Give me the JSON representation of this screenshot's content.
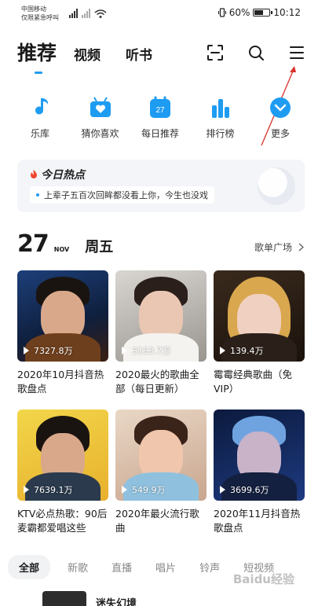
{
  "status_bar": {
    "carrier_line1": "中国移动",
    "carrier_line2": "仅限紧急呼叫",
    "battery": "60%",
    "time": "10:12",
    "battery_level": 0.6
  },
  "top_tabs": {
    "active": "推荐",
    "items": [
      "视频",
      "听书"
    ],
    "icons": [
      "scan-icon",
      "search-icon",
      "menu-icon"
    ]
  },
  "quick_entries": [
    {
      "label": "乐库",
      "icon": "music-note-icon",
      "color": "#1e9cf2"
    },
    {
      "label": "猜你喜欢",
      "icon": "heart-radio-icon",
      "color": "#1e9cf2"
    },
    {
      "label": "每日推荐",
      "icon": "calendar-icon",
      "color": "#1e9cf2",
      "badge": "27"
    },
    {
      "label": "排行榜",
      "icon": "chart-bars-icon",
      "color": "#1e9cf2"
    },
    {
      "label": "更多",
      "icon": "chevron-down-icon",
      "color": "#1e9cf2"
    }
  ],
  "hot": {
    "title": "今日热点",
    "line": "上辈子五百次回眸都没看上你，今生也没戏"
  },
  "date": {
    "day": "27",
    "month": "NOV",
    "weekday": "周五"
  },
  "playlist_square": "歌单广场",
  "playlists": [
    {
      "plays": "7327.8万",
      "title": "2020年10月抖音热歌盘点"
    },
    {
      "plays": "3153.7万",
      "title": "2020最火的歌曲全部（每日更新）"
    },
    {
      "plays": "139.4万",
      "title": "霉霉经典歌曲（免VIP）"
    },
    {
      "plays": "7639.1万",
      "title": "KTV必点热歌：90后麦霸都爱唱这些"
    },
    {
      "plays": "549.9万",
      "title": "2020年最火流行歌曲"
    },
    {
      "plays": "3699.6万",
      "title": "2020年11月抖音热歌盘点"
    }
  ],
  "categories": [
    "全部",
    "新歌",
    "直播",
    "唱片",
    "铃声",
    "短视频"
  ],
  "bottom_item": "迷失幻境",
  "watermark": "Baidu经验",
  "accent_color": "#1e9cf2"
}
